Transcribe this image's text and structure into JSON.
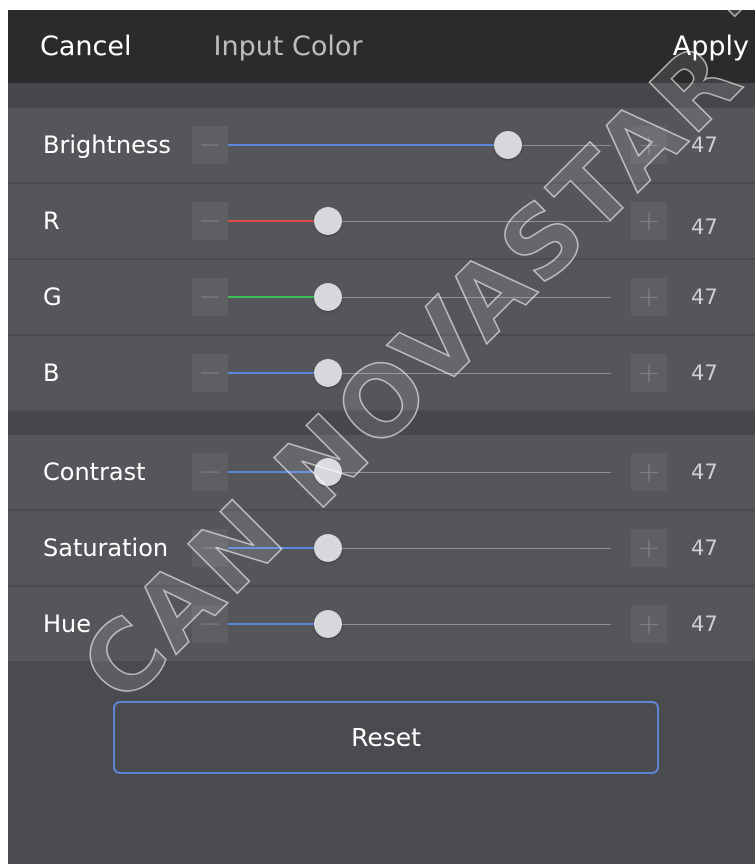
{
  "header": {
    "cancel_label": "Cancel",
    "title": "Input Color",
    "apply_label": "Apply"
  },
  "controls": {
    "minus_symbol": "−",
    "plus_symbol": "+"
  },
  "sliders": [
    {
      "label": "Brightness",
      "value": "47",
      "position": 0.73,
      "fill_color": "#5b86de"
    },
    {
      "label": "R",
      "value": "47",
      "position": 0.26,
      "fill_color": "#e04848"
    },
    {
      "label": "G",
      "value": "47",
      "position": 0.26,
      "fill_color": "#3fbf5a"
    },
    {
      "label": "B",
      "value": "47",
      "position": 0.26,
      "fill_color": "#5b86de"
    },
    {
      "label": "Contrast",
      "value": "47",
      "position": 0.26,
      "fill_color": "#5b86de"
    },
    {
      "label": "Saturation",
      "value": "47",
      "position": 0.26,
      "fill_color": "#5b86de"
    },
    {
      "label": "Hue",
      "value": "47",
      "position": 0.26,
      "fill_color": "#5b86de"
    }
  ],
  "reset_label": "Reset",
  "watermark": "CAN NOVASTAR T"
}
